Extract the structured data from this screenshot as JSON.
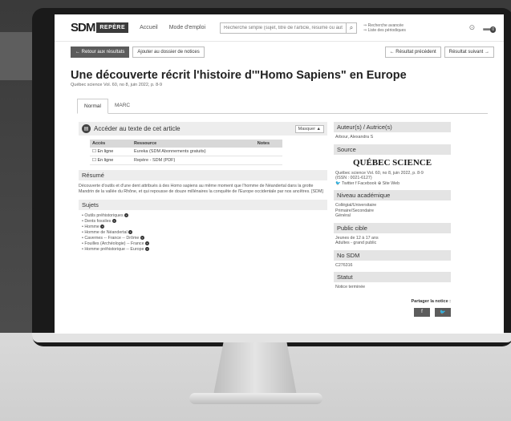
{
  "header": {
    "logo_sdm": "SDM",
    "logo_repere": "REPÈRE",
    "nav": [
      "Accueil",
      "Mode d'emploi"
    ],
    "search_placeholder": "Recherche simple (sujet, titre de l'article, résumé ou auteur)",
    "adv_links": [
      "⇒ Recherche avancée",
      "⇒ Liste des périodiques"
    ],
    "cart_count": "0"
  },
  "actions": {
    "back": "← Retour aux résultats",
    "add": "Ajouter au dossier de notices",
    "prev": "← Résultat précédent",
    "next": "Résultat suivant →"
  },
  "record": {
    "title": "Une découverte récrit l'histoire d'\"Homo Sapiens\" en Europe",
    "subtitle": "Québec science Vol. 60, no 8, juin 2022, p. 8-9"
  },
  "tabs": [
    "Normal",
    "MARC"
  ],
  "access": {
    "title": "Accéder au texte de cet article",
    "toggle": "Masquer ▲",
    "columns": [
      "Accès",
      "Ressource",
      "Notes"
    ],
    "rows": [
      {
        "access": "☐ En ligne",
        "resource": "Eureka (SDM Abonnements gratuits)",
        "notes": ""
      },
      {
        "access": "☐ En ligne",
        "resource": "Repère - SDM (PDF)",
        "notes": ""
      }
    ]
  },
  "summary": {
    "heading": "Résumé",
    "text": "Découverte d'outils et d'une dent attribués à des Homo sapiens au même moment que l'homme de Néandertal dans la grotte Mandrin de la vallée du Rhône, et qui repousse de douze millénaires la conquête de l'Europe occidentale par nos ancêtres. [SDM]"
  },
  "subjects": {
    "heading": "Sujets",
    "items": [
      "Outils préhistoriques",
      "Dents fossiles",
      "Homme",
      "Homme de Néandertal",
      "Cavernes -- France -- Drôme",
      "Fouilles (Archéologie) -- France",
      "Homme préhistorique -- Europe"
    ]
  },
  "sidebar": {
    "author_heading": "Auteur(s) / Autrice(s)",
    "author": "Arbour, Alexandra S",
    "source_heading": "Source",
    "source_logo": "QUÉBEC SCIENCE",
    "source_text": "Québec science Vol. 60, no 8, juin 2022, p. 8-9",
    "issn": "(ISSN : 0021-6127)",
    "source_links": "🐦 Twitter  f Facebook  ⊕ Site Web",
    "level_heading": "Niveau académique",
    "levels": [
      "Collégial/Universitaire",
      "Primaire/Secondaire",
      "Général"
    ],
    "audience_heading": "Public cible",
    "audience": [
      "Jeunes de 12 à 17 ans",
      "Adultes - grand public"
    ],
    "sdm_heading": "No SDM",
    "sdm_number": "C276316",
    "status_heading": "Statut",
    "status": "Notice terminée",
    "share_label": "Partager la notice :"
  }
}
